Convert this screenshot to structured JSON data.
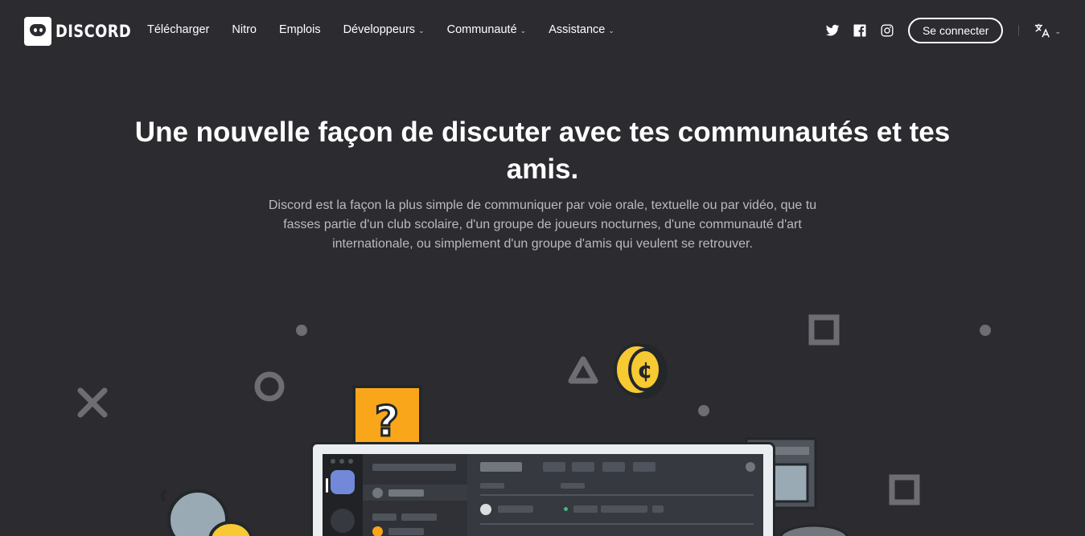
{
  "brand": {
    "name": "DISCORD"
  },
  "nav": {
    "links": [
      {
        "label": "Télécharger",
        "has_menu": false
      },
      {
        "label": "Nitro",
        "has_menu": false
      },
      {
        "label": "Emplois",
        "has_menu": false
      },
      {
        "label": "Développeurs",
        "has_menu": true
      },
      {
        "label": "Communauté",
        "has_menu": true
      },
      {
        "label": "Assistance",
        "has_menu": true
      }
    ],
    "social": [
      "twitter-icon",
      "facebook-icon",
      "instagram-icon"
    ],
    "login_label": "Se connecter",
    "language_icon": "translate-icon"
  },
  "hero": {
    "title": "Une nouvelle façon de discuter avec tes communautés et tes amis.",
    "subtitle": "Discord est la façon la plus simple de communiquer par voie orale, textuelle ou par vidéo, que tu fasses partie d'un club scolaire, d'un groupe de joueurs nocturnes, d'une communauté d'art internationale, ou simplement d'un groupe d'amis qui veulent se retrouver."
  },
  "colors": {
    "background": "#2c2b30",
    "accent": "#7289da",
    "coin": "#f7c932",
    "question_block": "#faa61a",
    "shape_grey": "#6e6d73"
  }
}
